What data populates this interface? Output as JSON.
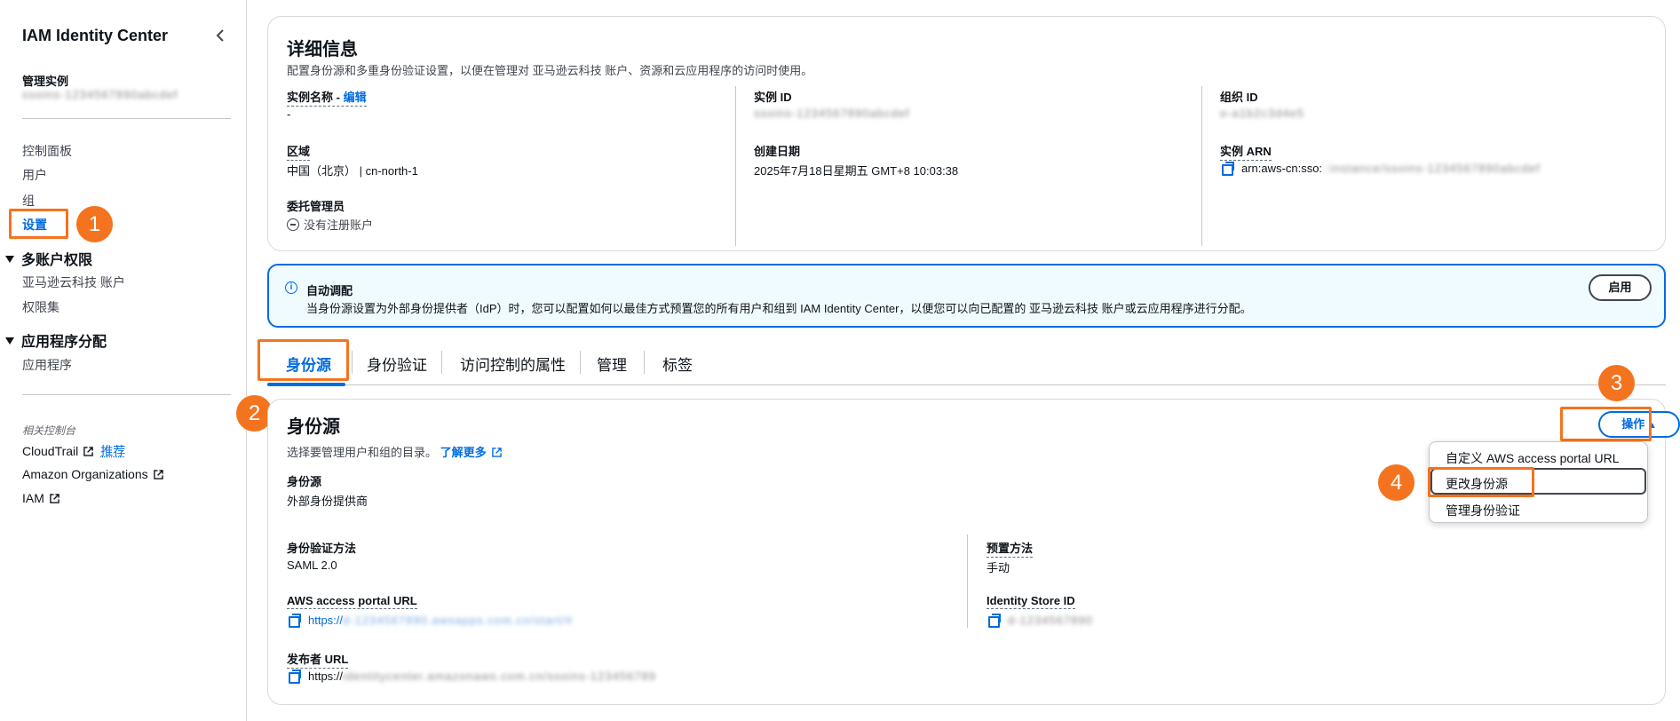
{
  "sidebar": {
    "title": "IAM Identity Center",
    "instance_label": "管理实例",
    "instance_value": "ssoins-1234567890abcdef",
    "nav": [
      {
        "label": "控制面板"
      },
      {
        "label": "用户"
      },
      {
        "label": "组"
      },
      {
        "label": "设置",
        "active": true
      }
    ],
    "groups": [
      {
        "label": "多账户权限",
        "items": [
          "亚马逊云科技 账户",
          "权限集"
        ]
      },
      {
        "label": "应用程序分配",
        "items": [
          "应用程序"
        ]
      }
    ],
    "related_title": "相关控制台",
    "related": [
      {
        "label": "CloudTrail",
        "badge": "推荐"
      },
      {
        "label": "Amazon Organizations"
      },
      {
        "label": "IAM"
      }
    ]
  },
  "details": {
    "title": "详细信息",
    "description": "配置身份源和多重身份验证设置，以便在管理对 亚马逊云科技 账户、资源和云应用程序的访问时使用。",
    "instance_name_label": "实例名称",
    "edit_label": "编辑",
    "instance_name_value": "-",
    "instance_id_label": "实例 ID",
    "instance_id_value": "ssoins-1234567890abcdef",
    "org_id_label": "组织 ID",
    "org_id_value": "o-a1b2c3d4e5",
    "region_label": "区域",
    "region_value": "中国（北京） | cn-north-1",
    "created_label": "创建日期",
    "created_value": "2025年7月18日星期五 GMT+8 10:03:38",
    "arn_label": "实例 ARN",
    "arn_prefix": "arn:aws-cn:sso:",
    "arn_value": "::instance/ssoins-1234567890abcdef",
    "delegated_label": "委托管理员",
    "delegated_value": "没有注册账户"
  },
  "banner": {
    "title": "自动调配",
    "text": "当身份源设置为外部身份提供者（IdP）时，您可以配置如何以最佳方式预置您的所有用户和组到 IAM Identity Center，以便您可以向已配置的 亚马逊云科技 账户或云应用程序进行分配。",
    "button": "启用"
  },
  "tabs": [
    "身份源",
    "身份验证",
    "访问控制的属性",
    "管理",
    "标签"
  ],
  "identity_source": {
    "title": "身份源",
    "description": "选择要管理用户和组的目录。",
    "learn_more": "了解更多",
    "actions_button": "操作",
    "source_label": "身份源",
    "source_value": "外部身份提供商",
    "auth_label": "身份验证方法",
    "auth_value": "SAML 2.0",
    "provision_label": "预置方法",
    "provision_value": "手动",
    "portal_label": "AWS access portal URL",
    "portal_prefix": "https://",
    "portal_value": "d-1234567890.awsapps.com.cn/start/#",
    "store_label": "Identity Store ID",
    "store_value": "d-1234567890",
    "issuer_label": "发布者 URL",
    "issuer_prefix": "https://",
    "issuer_value": "identitycenter.amazonaws.com.cn/ssoins-123456789"
  },
  "actions_menu": [
    "自定义 AWS access portal URL",
    "更改身份源",
    "管理身份验证"
  ],
  "steps": [
    "1",
    "2",
    "3",
    "4"
  ],
  "colors": {
    "accent": "#006ce0",
    "highlight": "#f4731f"
  }
}
